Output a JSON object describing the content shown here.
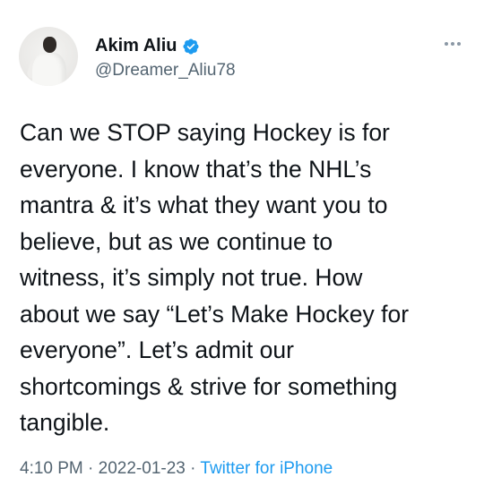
{
  "author": {
    "display_name": "Akim Aliu",
    "handle": "@Dreamer_Aliu78",
    "verified_icon": "verified-badge-icon"
  },
  "tweet": {
    "text": "Can we STOP saying Hockey is for\neveryone. I know that’s the NHL’s\nmantra & it’s what they want you to\nbelieve, but as we continue to\nwitness, it’s simply not true. How\nabout we say “Let’s Make Hockey for\neveryone”. Let’s admit our\nshortcomings & strive for something\ntangible."
  },
  "meta": {
    "time": "4:10 PM",
    "separator": "·",
    "date": "2022-01-23",
    "source": "Twitter for iPhone"
  },
  "colors": {
    "text": "#0f1419",
    "secondary": "#536471",
    "link": "#1d9bf0",
    "verified": "#1d9bf0"
  },
  "icons": {
    "more": "more-options-icon"
  }
}
